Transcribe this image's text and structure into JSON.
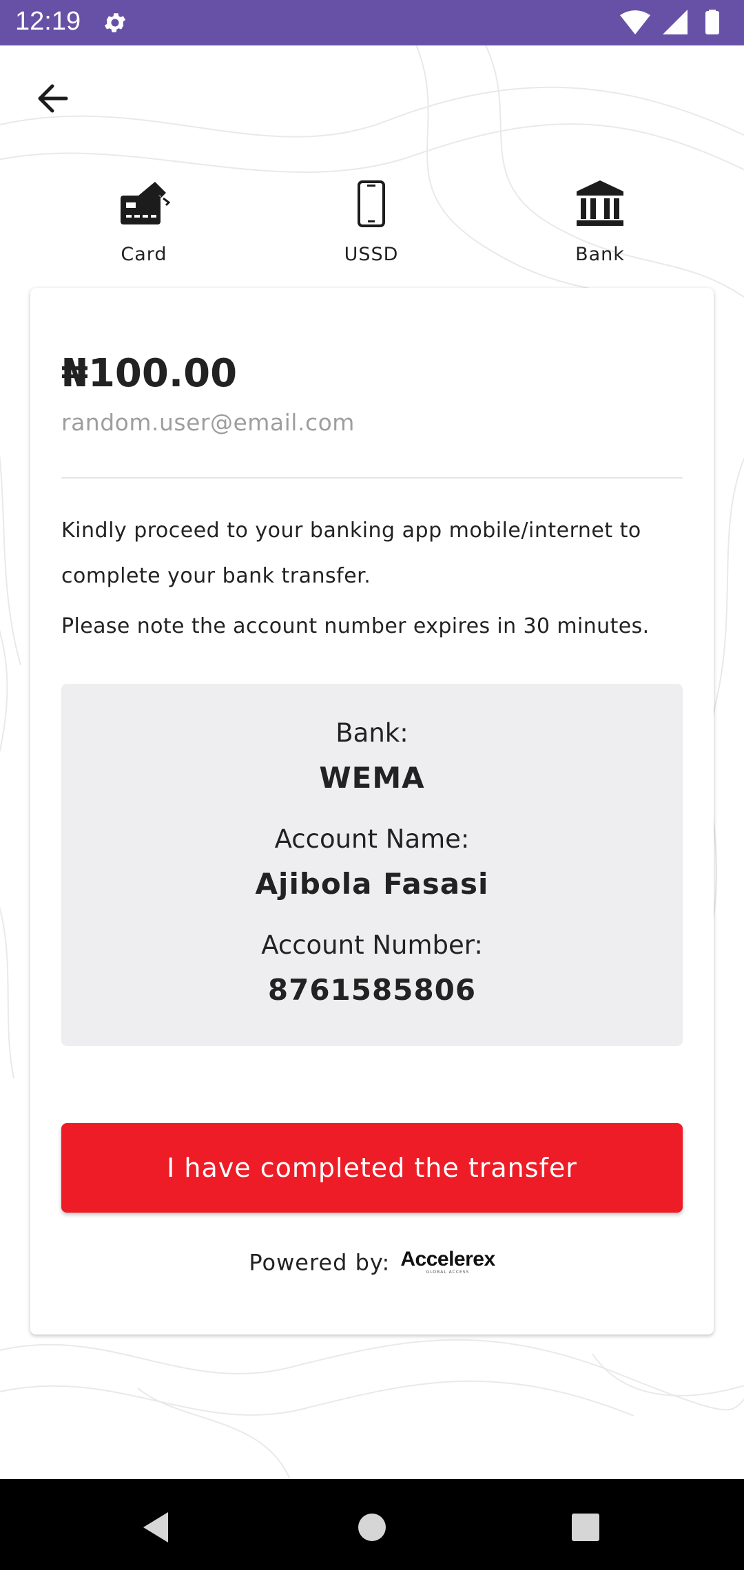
{
  "status_bar": {
    "time": "12:19",
    "icons": [
      "gear-icon",
      "wifi-icon",
      "signal-icon",
      "battery-icon"
    ]
  },
  "header": {
    "back_icon": "arrow-left-icon"
  },
  "payment_tabs": [
    {
      "label": "Card",
      "icon": "card-icon"
    },
    {
      "label": "USSD",
      "icon": "phone-icon"
    },
    {
      "label": "Bank",
      "icon": "bank-icon"
    }
  ],
  "payment": {
    "amount": "₦100.00",
    "email": "random.user@email.com"
  },
  "instructions": {
    "line1": "Kindly proceed to your banking app mobile/internet to complete your bank transfer.",
    "line2": "Please note the account number expires in 30 minutes."
  },
  "account": {
    "bank_label": "Bank:",
    "bank_value": "WEMA",
    "name_label": "Account Name:",
    "name_value": "Ajibola Fasasi",
    "number_label": "Account Number:",
    "number_value": "8761585806"
  },
  "cta": {
    "label": "I have completed the transfer"
  },
  "footer": {
    "powered_label": "Powered by:",
    "brand": "Accelerex",
    "brand_tagline": "GLOBAL ACCESS"
  },
  "colors": {
    "status_bar": "#6751a6",
    "cta": "#ee1c27",
    "details_bg": "#eeeef0"
  },
  "nav_bar": {
    "icons": [
      "back-triangle-icon",
      "home-circle-icon",
      "recents-square-icon"
    ]
  }
}
